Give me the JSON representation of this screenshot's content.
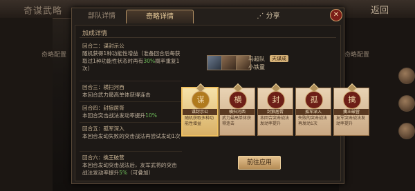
{
  "topbar": {
    "title": "奇谋武略",
    "back": "返回"
  },
  "sidebars": {
    "left_label": "奇略配置",
    "right_label": "奇略配置"
  },
  "tabs": [
    {
      "label": "部队详情"
    },
    {
      "label": "奇略详情"
    },
    {
      "label": "分享"
    }
  ],
  "close_label": "✕",
  "section_title": "加成详情",
  "rounds": [
    {
      "label": "回合二：",
      "name": "谋封示公",
      "desc": "随机获得1种功能性增益（准备回合后每获取过1种功能性状态时再有",
      "hl": "30%",
      "tail": "概率重复1次）"
    },
    {
      "label": "回合三：",
      "name": "横扫河西",
      "desc": "本回合武力最高单体获得连击",
      "hl": "",
      "tail": ""
    },
    {
      "label": "回合四：",
      "name": "封狼居胥",
      "desc": "本回合突击战法发动率提升",
      "hl": "10%",
      "tail": ""
    },
    {
      "label": "回合五：",
      "name": "孤军深入",
      "desc": "本回合发动失败的突击战法再尝试发动1次",
      "hl": "",
      "tail": ""
    },
    {
      "label": "回合六：",
      "name": "擒王破营",
      "desc": "本回合发动突击战法后，友军武将的突击战法发动率提升",
      "hl": "5%",
      "tail": "（可叠加）"
    }
  ],
  "team": {
    "name": "马超队",
    "badge": "天谋成",
    "leader": "小铁童"
  },
  "cards": [
    {
      "name": "谋封示公",
      "icon": "谋",
      "desc": "随机获取多种功能性增益",
      "selected": true
    },
    {
      "name": "横扫河西",
      "icon": "横",
      "desc": "武力最高单体获得连击",
      "selected": false
    },
    {
      "name": "封狼居胥",
      "icon": "封",
      "desc": "本回合突击战法发动率提升",
      "selected": false
    },
    {
      "name": "孤军深入",
      "icon": "孤",
      "desc": "失败的突击战法再发动1次",
      "selected": false
    },
    {
      "name": "擒王破营",
      "icon": "擒",
      "desc": "友军突击战法发动率提升",
      "selected": false
    }
  ],
  "apply_label": "前往应用",
  "colors": {
    "accent": "#e6c999",
    "highlight": "#6fbf5b",
    "close": "#7b1e18"
  }
}
